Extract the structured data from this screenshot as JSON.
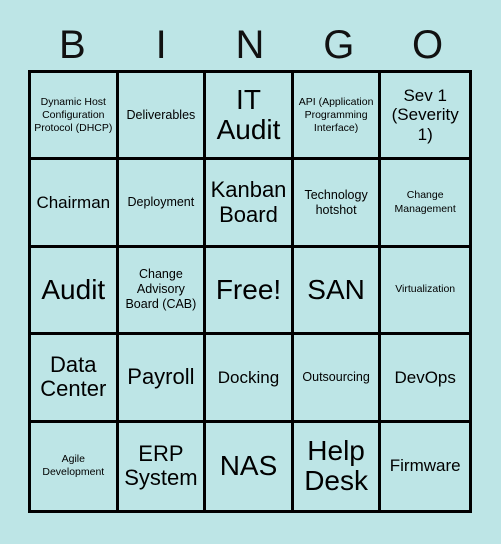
{
  "card": {
    "title_letters": [
      "B",
      "I",
      "N",
      "G",
      "O"
    ],
    "grid_size": "5x5",
    "background_color": "#bde5e6",
    "border_color": "#000000",
    "text_color": "#000000",
    "free_space_label": "Free!",
    "rows": [
      [
        {
          "text": "Dynamic Host Configuration Protocol (DHCP)",
          "size": "xs"
        },
        {
          "text": "Deliverables",
          "size": "s"
        },
        {
          "text": "IT Audit",
          "size": "xl"
        },
        {
          "text": "API (Application Programming Interface)",
          "size": "xs"
        },
        {
          "text": "Sev 1 (Severity 1)",
          "size": "m"
        }
      ],
      [
        {
          "text": "Chairman",
          "size": "m"
        },
        {
          "text": "Deployment",
          "size": "s"
        },
        {
          "text": "Kanban Board",
          "size": "l"
        },
        {
          "text": "Technology hotshot",
          "size": "s"
        },
        {
          "text": "Change Management",
          "size": "xs"
        }
      ],
      [
        {
          "text": "Audit",
          "size": "xl"
        },
        {
          "text": "Change Advisory Board (CAB)",
          "size": "s"
        },
        {
          "text": "Free!",
          "size": "xl"
        },
        {
          "text": "SAN",
          "size": "xl"
        },
        {
          "text": "Virtualization",
          "size": "xs"
        }
      ],
      [
        {
          "text": "Data Center",
          "size": "l"
        },
        {
          "text": "Payroll",
          "size": "l"
        },
        {
          "text": "Docking",
          "size": "m"
        },
        {
          "text": "Outsourcing",
          "size": "s"
        },
        {
          "text": "DevOps",
          "size": "m"
        }
      ],
      [
        {
          "text": "Agile Development",
          "size": "xs"
        },
        {
          "text": "ERP System",
          "size": "l"
        },
        {
          "text": "NAS",
          "size": "xl"
        },
        {
          "text": "Help Desk",
          "size": "xl"
        },
        {
          "text": "Firmware",
          "size": "m"
        }
      ]
    ]
  }
}
